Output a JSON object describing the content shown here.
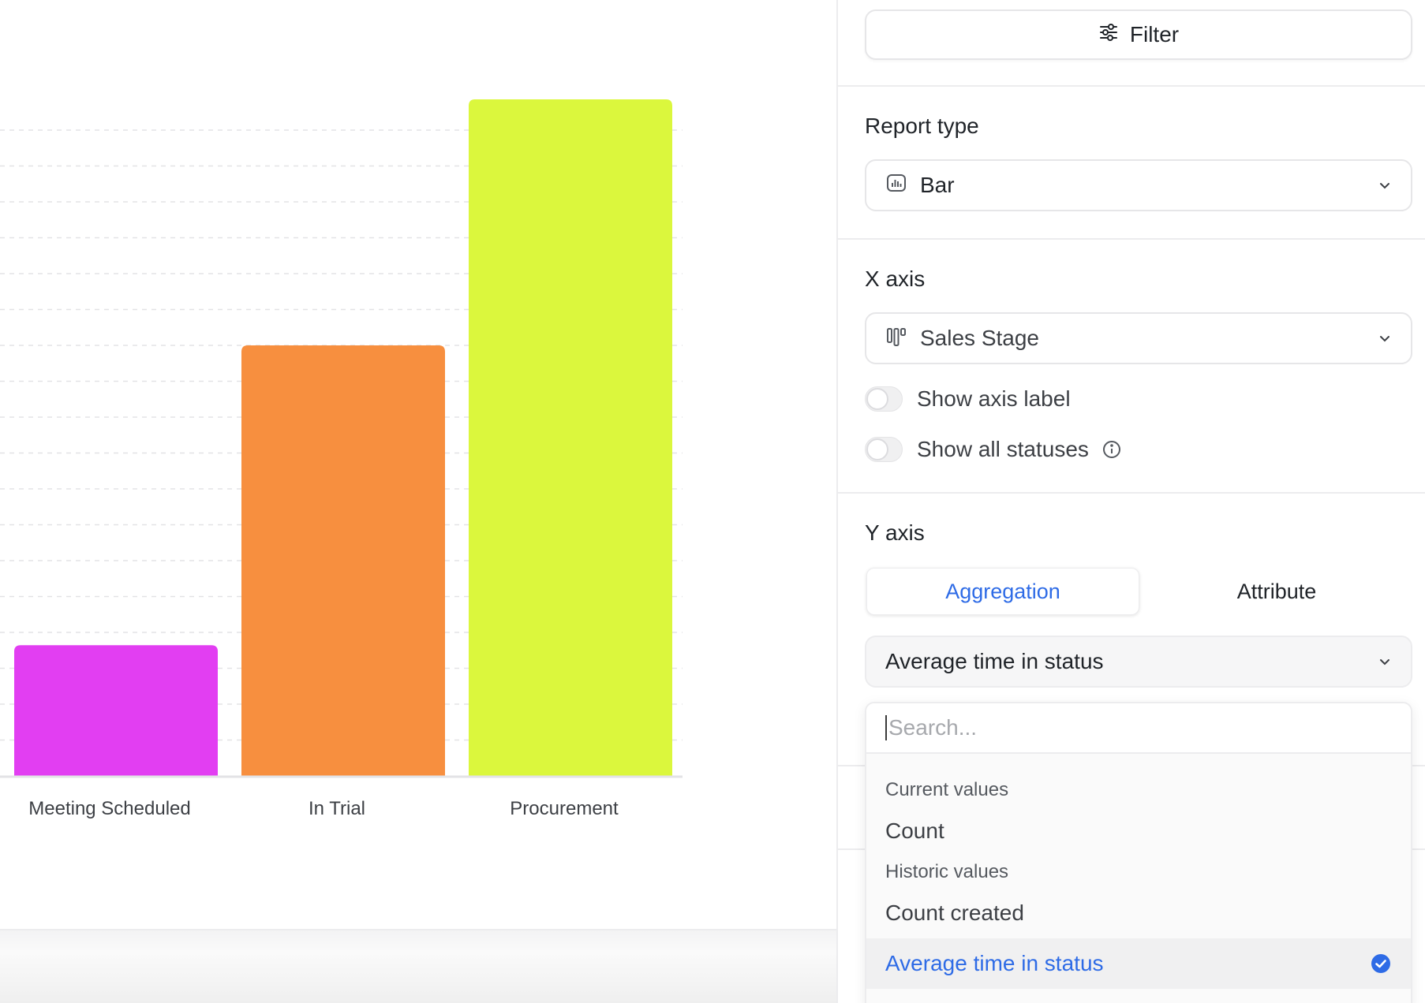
{
  "chart_data": {
    "type": "bar",
    "categories": [
      "Meeting Scheduled",
      "In Trial",
      "Procurement"
    ],
    "values": [
      17,
      56,
      88
    ],
    "colors": [
      "#e23ef2",
      "#f78f3f",
      "#dbf73d"
    ],
    "ylim": [
      0,
      100
    ],
    "grid": true,
    "title": "",
    "xlabel": "",
    "ylabel": ""
  },
  "panel": {
    "filter_label": "Filter",
    "report_type": {
      "label": "Report type",
      "value": "Bar",
      "icon": "bar-chart-icon"
    },
    "x_axis": {
      "label": "X axis",
      "value": "Sales Stage",
      "icon": "kanban-columns-icon",
      "show_axis_label": "Show axis label",
      "show_all_statuses": "Show all statuses"
    },
    "y_axis": {
      "label": "Y axis",
      "tabs": [
        "Aggregation",
        "Attribute"
      ],
      "active_tab": "Aggregation",
      "selected": "Average time in status"
    },
    "dropdown": {
      "search_placeholder": "Search...",
      "groups": [
        {
          "label": "Current values",
          "items": [
            "Count"
          ]
        },
        {
          "label": "Historic values",
          "items": [
            "Count created",
            "Average time in status"
          ]
        }
      ],
      "selected_item": "Average time in status"
    },
    "accent_color": "#2e6be6"
  }
}
